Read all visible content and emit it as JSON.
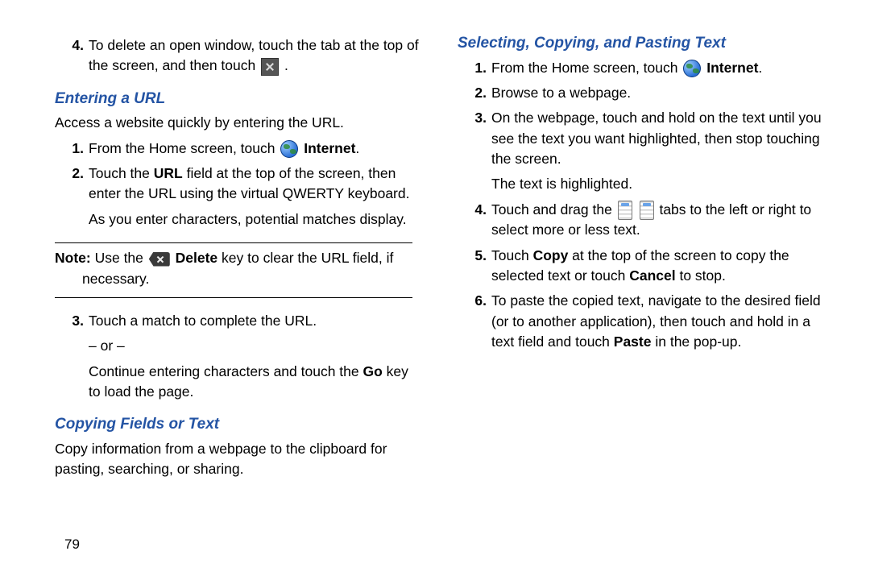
{
  "page_number": "79",
  "left": {
    "step4_pre": "To delete an open window, touch the tab at the top of the screen, and then touch ",
    "step4_post": " .",
    "heading_url": "Entering a URL",
    "intro_url": "Access a website quickly by entering the URL.",
    "u1_pre": "From the Home screen, touch ",
    "u1_bold": "Internet",
    "u1_post": ".",
    "u2_a": "Touch the ",
    "u2_bold": "URL",
    "u2_b": " field at the top of the screen, then enter the URL using the virtual QWERTY keyboard.",
    "u2_sub": "As you enter characters, potential matches display.",
    "note_label": "Note:",
    "note_a": " Use the ",
    "note_bold": "Delete",
    "note_b": " key to clear the URL field, if necessary.",
    "u3_a": "Touch a match to complete the URL.",
    "u3_or": "– or –",
    "u3_b_pre": "Continue entering characters and touch the ",
    "u3_b_bold": "Go",
    "u3_b_post": " key to load the page.",
    "heading_copy": "Copying Fields or Text",
    "intro_copy": "Copy information from a webpage to the clipboard for pasting, searching, or sharing."
  },
  "right": {
    "heading_sel": "Selecting, Copying, and Pasting Text",
    "s1_pre": "From the Home screen, touch ",
    "s1_bold": "Internet",
    "s1_post": ".",
    "s2": "Browse to a webpage.",
    "s3_a": "On the webpage, touch and hold on the text until you see the text you want highlighted, then stop touching the screen.",
    "s3_sub": "The text is highlighted.",
    "s4_pre": "Touch and drag the ",
    "s4_post": " tabs to the left or right to select more or less text.",
    "s5_a": "Touch ",
    "s5_b1": "Copy",
    "s5_b": " at the top of the screen to copy the selected text or touch ",
    "s5_b2": "Cancel",
    "s5_c": " to stop.",
    "s6_a": "To paste the copied text, navigate to the desired field (or to another application), then touch and hold in a text field and touch ",
    "s6_b": "Paste",
    "s6_c": " in the pop-up."
  }
}
